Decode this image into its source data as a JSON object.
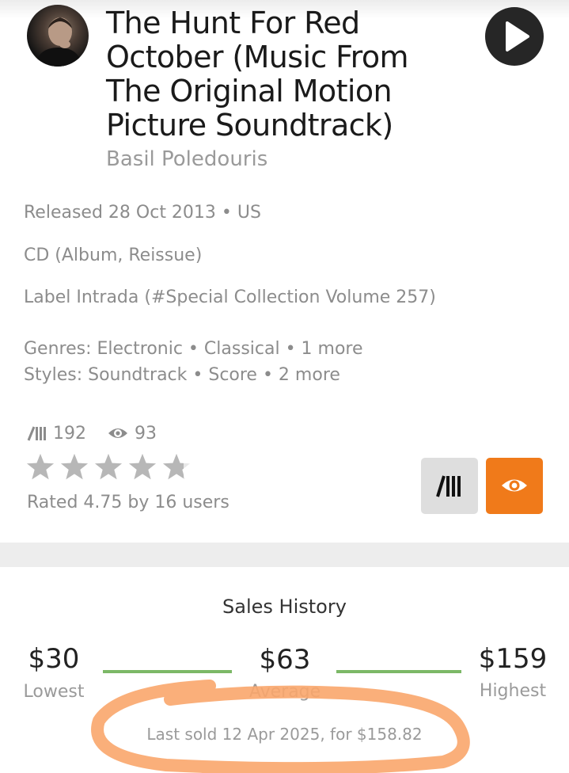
{
  "release": {
    "title": "The Hunt For Red October (Music From The Original Motion Picture Soundtrack)",
    "artist": "Basil Poledouris",
    "released": "Released 28 Oct 2013 • US",
    "format": "CD (Album, Reissue)",
    "label": "Label Intrada (#Special Collection Volume 257)",
    "genres": "Genres: Electronic • Classical • 1 more",
    "styles": "Styles: Soundtrack • Score • 2 more"
  },
  "stats": {
    "have_count": "192",
    "want_count": "93",
    "rating": 4.75,
    "rating_max": 5,
    "rated_text": "Rated 4.75 by 16 users"
  },
  "icons": {
    "avatar": "artist-photo",
    "play": "play-icon",
    "collection": "collection-icon",
    "wantlist": "eye-icon",
    "star": "star-icon"
  },
  "sales_history": {
    "title": "Sales History",
    "lowest_value": "$30",
    "lowest_label": "Lowest",
    "average_value": "$63",
    "average_label": "Average",
    "highest_value": "$159",
    "highest_label": "Highest",
    "last_sold": "Last sold 12 Apr 2025, for $158.82"
  },
  "colors": {
    "accent_orange": "#f07a1a",
    "bar_green": "#7cb867",
    "annotation_orange": "#f9a66b",
    "star_gray": "#b7b7b7"
  }
}
